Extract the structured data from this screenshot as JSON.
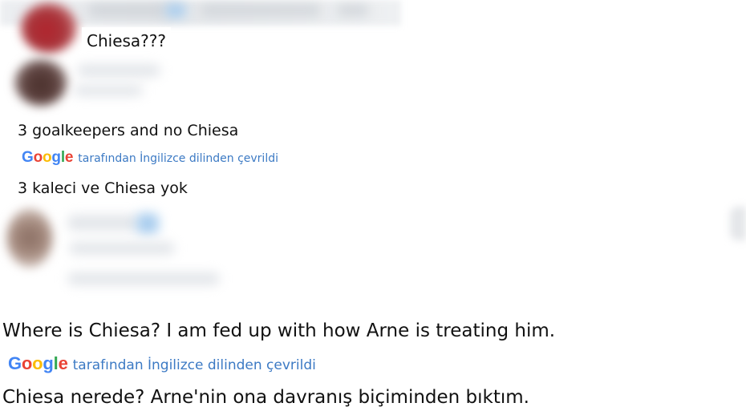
{
  "google_logo": {
    "letters": [
      {
        "char": "G",
        "color": "#4285F4"
      },
      {
        "char": "o",
        "color": "#EA4335"
      },
      {
        "char": "o",
        "color": "#FBBC05"
      },
      {
        "char": "g",
        "color": "#4285F4"
      },
      {
        "char": "l",
        "color": "#34A853"
      },
      {
        "char": "e",
        "color": "#EA4335"
      }
    ]
  },
  "translation_label_color": "#3c7ac4",
  "replies": [
    {
      "text": "Chiesa???"
    },
    {
      "original_text": "3 goalkeepers and no Chiesa",
      "translated_by": "tarafından İngilizce dilinden çevrildi",
      "translated_text": "3 kaleci ve Chiesa yok"
    },
    {
      "original_text": "Where is Chiesa? I am fed up with how Arne is treating him.",
      "translated_by": "tarafından İngilizce dilinden çevrildi",
      "translated_text": "Chiesa nerede? Arne'nin ona davranış biçiminden bıktım."
    }
  ]
}
